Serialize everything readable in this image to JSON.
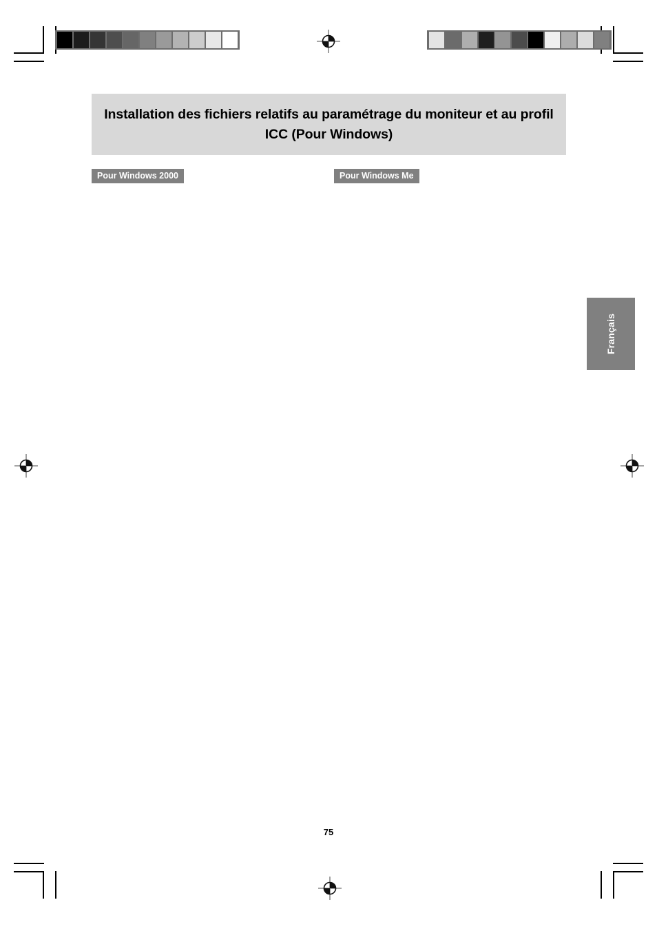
{
  "page": {
    "number": "75",
    "language_tab": "Français",
    "background_color": "#ffffff"
  },
  "title_block": {
    "text": "Installation des fichiers relatifs au paramétrage du moniteur et au profil ICC (Pour Windows)",
    "background_color": "#d8d8d8",
    "text_color": "#000000"
  },
  "sections": [
    {
      "id": "windows-2000",
      "label": "Pour Windows 2000",
      "background_color": "#808080",
      "text_color": "#ffffff"
    },
    {
      "id": "windows-me",
      "label": "Pour Windows Me",
      "background_color": "#808080",
      "text_color": "#ffffff"
    }
  ],
  "print_marks": {
    "registration_icon": "registration-target-icon",
    "crop_icon": "crop-mark-icon",
    "calibration_strip_left": {
      "name": "grayscale-calibration-strip",
      "frame_color": "#6d6d6d",
      "patches": [
        "#000000",
        "#1c1c1c",
        "#353535",
        "#4e4e4e",
        "#666666",
        "#808080",
        "#9a9a9a",
        "#b3b3b3",
        "#cccccc",
        "#e8e8e8",
        "#ffffff"
      ]
    },
    "calibration_strip_right": {
      "name": "grayscale-calibration-strip-scrambled",
      "frame_color": "#6d6d6d",
      "patches": [
        "#e4e4e4",
        "#6b6b6b",
        "#aeaeae",
        "#1f1f1f",
        "#949494",
        "#4c4c4c",
        "#000000",
        "#f0f0f0",
        "#adadad",
        "#dcdcdc",
        "#808080"
      ]
    }
  }
}
